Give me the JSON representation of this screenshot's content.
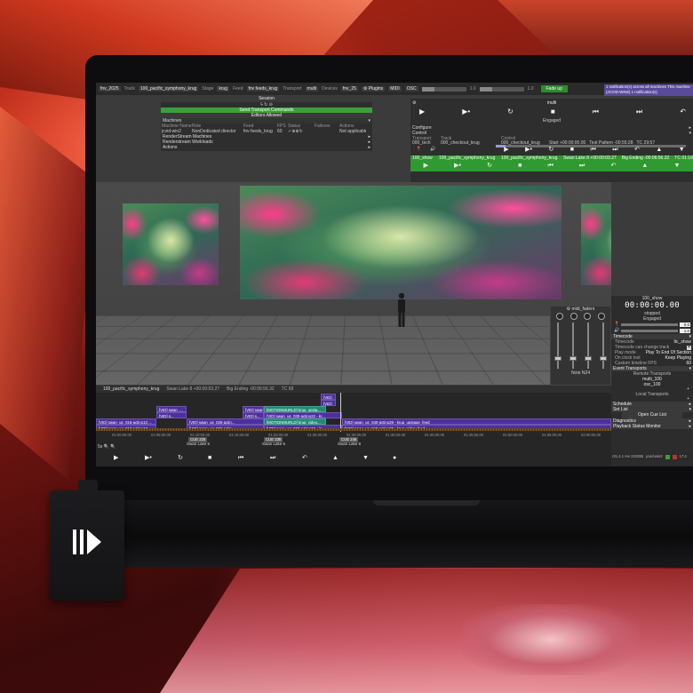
{
  "app": {
    "topbar": {
      "project": "fnv_2025",
      "track_label": "Track",
      "track_value": "100_pacific_symphony_krug",
      "stage_label": "Stage",
      "stage_value": "krug",
      "feed_label": "Feed",
      "feed_value": "fnv feeds_krug",
      "transport_label": "Transport",
      "transport_value": "multi",
      "devices_label": "Devices",
      "devices_value": "fnv_25",
      "plugins_label": "Plugins",
      "midi_label": "MIDI",
      "osc_label": "OSC",
      "fade_value": "1.0",
      "fade_value2": "1.0",
      "fade_button": "Fade up",
      "notification": "1 notification(s) across all machines This machine (JCVID-WIN2) 1 notification(s)"
    },
    "session": {
      "title": "Session",
      "send_transport": "Send Transport Commands",
      "editors_allowed": "Editors Allowed",
      "machines_label": "Machines",
      "headers": [
        "Machine Name",
        "Role",
        "Feed",
        "FPS",
        "Status",
        "Failover",
        "Actions"
      ],
      "row": [
        "jcvid-win2",
        "NonDedicated director",
        "fnv feeds_krug",
        "60",
        "",
        "Not applicable",
        ""
      ],
      "sections": [
        "RenderStream Machines",
        "Renderstream Workloads",
        "Actions"
      ]
    },
    "transport": {
      "name": "multi",
      "status": "Engaged",
      "configure": "Configure",
      "control": "Control",
      "transport_header": "Transport",
      "track_header": "Track",
      "control_header": "Control",
      "tech_name": "000_tech",
      "tech_track": "000_checkout_krug",
      "tech_control": "000_checkout_krug",
      "tech_start": "Start +00:00:00.00",
      "tech_pattern": "Test Pattern -00:55:28",
      "tech_tc": "TC 29:57",
      "tech_progress": 0.05,
      "show_name": "100_show",
      "show_track": "100_pacific_symphony_krug",
      "show_control": "100_pacific_symphony_krug",
      "show_section": "Swan Lake 8 +00:00:03.27",
      "show_ending": "Big Ending -00:06:56.32",
      "show_tc": "TC 01:16",
      "show_progress": 0.3
    },
    "midi": {
      "title": "midi_faders",
      "fader_levels": [
        0.2,
        0.2,
        0.2,
        0.2
      ],
      "note": "Note N24"
    },
    "right_panel": {
      "show_name": "100_show",
      "timecode": "00:00:00.00",
      "state": "stopped",
      "engaged": "Engaged",
      "level_a": "0.0",
      "level_b": "1.0",
      "timecode_section": "Timecode",
      "timecode_label": "Timecode",
      "timecode_value": "ltc_show",
      "can_change_label": "Timecode can change track",
      "play_mode_label": "Play mode",
      "play_mode_value": "Play To End Of Section",
      "on_clock_lost_label": "On clock lost",
      "on_clock_lost_value": "Keep Playing",
      "custom_fps_label": "Custom timeline FPS",
      "custom_fps_value": "60",
      "event_transports": "Event Transports",
      "remote_transports": "Remote Transports",
      "remote_1": "multi_100",
      "remote_2": "osc_100",
      "local_transports": "Local Transports",
      "schedule": "Schedule",
      "set_list": "Set List",
      "open_cue_list": "Open Cue List",
      "diagnostics": "Diagnostics",
      "playback_monitor": "Playback Status Monitor",
      "footer_version": "r31.4.1 rev 222355",
      "footer_machine": "jcvid-win2",
      "footer_time": "17:4"
    },
    "timeline": {
      "track": "100_pacific_symphony_krug",
      "section": "Swan Lake 8 +00:00:03.27",
      "ending": "Big Ending -00:06:56.32",
      "tc": "TC 68",
      "clips": {
        "vid_top_1": "[VID]",
        "vid_top_2": "[VID]",
        "vid_small_1": "[VID] swan_...",
        "vid_small_2": "[VID] swan_...",
        "vid_small_3": "[VID] s...",
        "motion_1": "[MOTIONMURLD] krug_upsta...",
        "vid_mid": "[VID] swan_us_030-actino22 - kr...",
        "vid_long_1": "[VID] swan_us_040-actino29 - krug_upstage_feed",
        "vid_row3_1": "[VID] swan_us_018-actino13 ...",
        "vid_row3_2": "[VID] swan_us_025-actin...",
        "vid_row3_3": "[VID] s...",
        "motion_2": "[MOTIONMURLD] krug_video...",
        "vid_row4_1": "[VID] swan_us_018-actino13 ...",
        "vid_row4_2": "[VID] swan_us_025-actin...",
        "vid_row4_3": "[VID] swan_us_030-actino22 - kr...",
        "vid_long_2": "[VID] swan_us_040-actino29 - krug_sides_feed"
      },
      "ruler": [
        "01:00:00.00",
        "01:05:00.00",
        "01:10:00.00",
        "01:15:00.00",
        "01:20:00.00",
        "01:25:00.00",
        "01:30:00.00",
        "01:35:00.00",
        "01:40:00.00",
        "01:45:00.00",
        "01:50:00.00",
        "01:55:00.00",
        "02:00:00.00"
      ],
      "cues": [
        {
          "cue": "CUE 225",
          "name": "Swan Lake 5"
        },
        {
          "cue": "CUE 235",
          "name": "Swan Lake 6"
        },
        {
          "cue": "CUE 245",
          "name": "Swan Lake 8"
        }
      ],
      "zoom": "5s"
    },
    "colors": {
      "accent_green": "#2f9a2f",
      "vid_clip": "#4d2f9e",
      "motion_clip": "#1e8a74",
      "notify_bg": "#5a4a9a",
      "background_red": "#b52a16"
    },
    "icons": {
      "play": "play-icon",
      "play_section": "play-section-icon",
      "loop": "loop-section-icon",
      "stop": "stop-icon",
      "prev": "previous-section-icon",
      "next": "next-section-icon",
      "return": "return-icon",
      "up": "up-icon",
      "down": "down-icon",
      "record": "record-icon"
    }
  }
}
